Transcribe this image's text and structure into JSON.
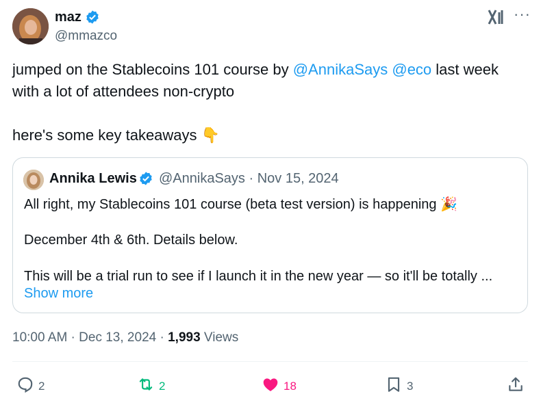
{
  "author": {
    "name": "maz",
    "handle": "@mmazco"
  },
  "tweet": {
    "line1_pre": "jumped on the Stablecoins 101 course by ",
    "mention1": "@AnnikaSays",
    "mention2": "@eco",
    "line1_post": " last week",
    "line2": "with a lot of attendees non-crypto",
    "line3": "here's some key takeaways",
    "emoji": "👇"
  },
  "quote": {
    "name": "Annika Lewis",
    "handle": "@AnnikaSays",
    "date": "Nov 15, 2024",
    "line1": "All right, my Stablecoins 101 course (beta test version) is happening",
    "emoji": "🎉",
    "line2": "December 4th & 6th. Details below.",
    "line3": "This will be a trial run to see if I launch it in the new year — so it'll be totally ...",
    "show_more": "Show more"
  },
  "meta": {
    "time": "10:00 AM",
    "date": "Dec 13, 2024",
    "views": "1,993",
    "views_label": "Views"
  },
  "actions": {
    "replies": "2",
    "reposts": "2",
    "likes": "18",
    "bookmarks": "3"
  },
  "colors": {
    "accent": "#1d9bf0",
    "retweet": "#00ba7c",
    "like": "#f91880",
    "muted": "#536471"
  }
}
